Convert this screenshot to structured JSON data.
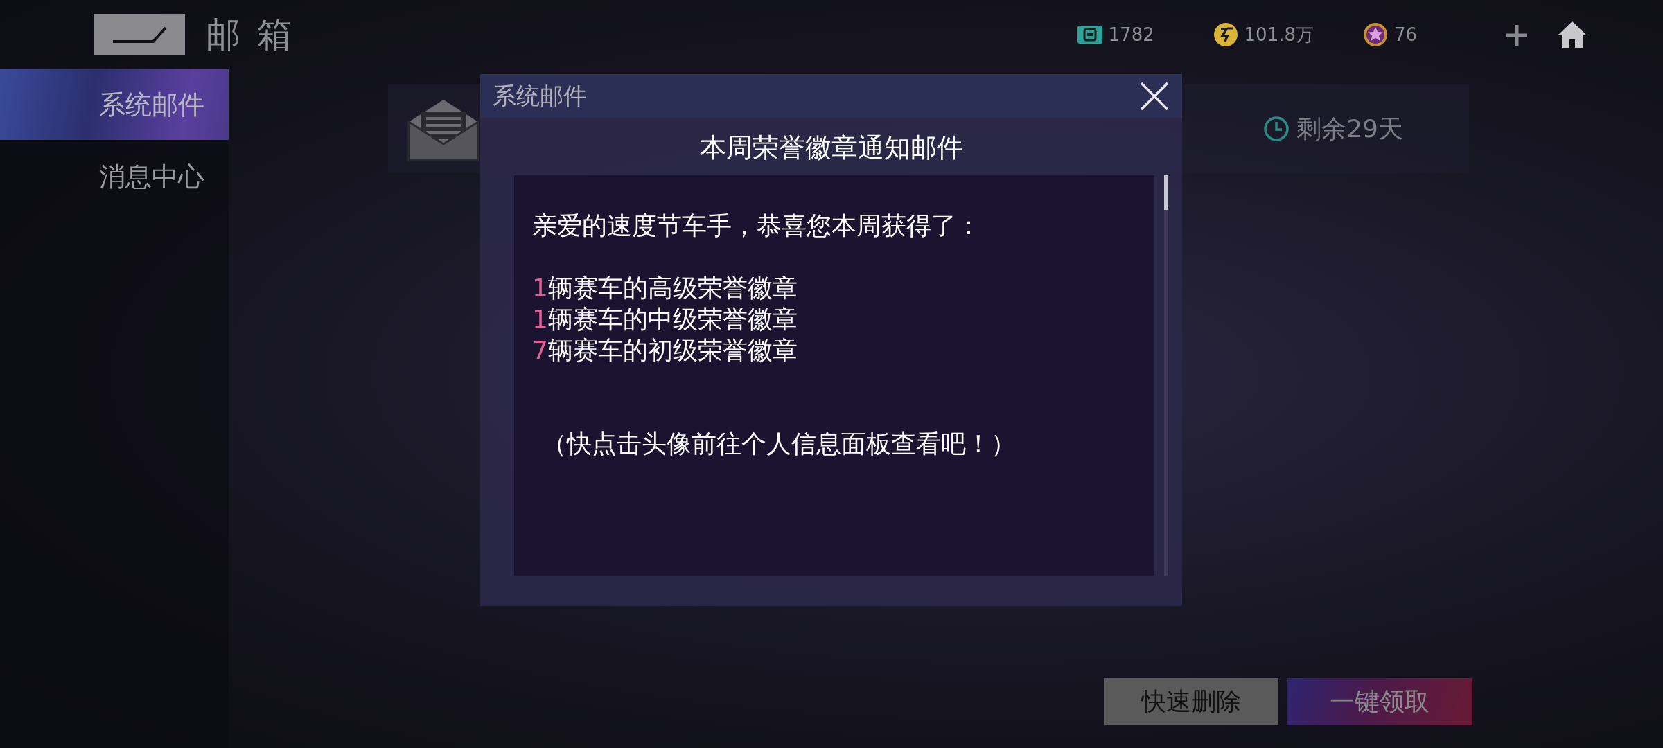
{
  "header": {
    "title": "邮 箱",
    "currencies": [
      {
        "kind": "ticket",
        "amount": "1782"
      },
      {
        "kind": "coin",
        "amount": "101.8万"
      },
      {
        "kind": "star",
        "amount": "76"
      }
    ]
  },
  "sidebar": {
    "items": [
      {
        "label": "系统邮件",
        "selected": true
      },
      {
        "label": "消息中心",
        "selected": false
      }
    ]
  },
  "mail_row": {
    "expiry": "剩余29天"
  },
  "dialog": {
    "title": "系统邮件",
    "subject": "本周荣誉徽章通知邮件",
    "greeting": "亲爱的速度节车手，恭喜您本周获得了：",
    "awards": [
      {
        "count": "1",
        "text": "辆赛车的高级荣誉徽章"
      },
      {
        "count": "1",
        "text": "辆赛车的中级荣誉徽章"
      },
      {
        "count": "7",
        "text": "辆赛车的初级荣誉徽章"
      }
    ],
    "hint": "（快点击头像前往个人信息面板查看吧！）"
  },
  "buttons": [
    {
      "kind": "plain",
      "label": "快速删除"
    },
    {
      "kind": "accent",
      "label": "一键领取"
    }
  ]
}
